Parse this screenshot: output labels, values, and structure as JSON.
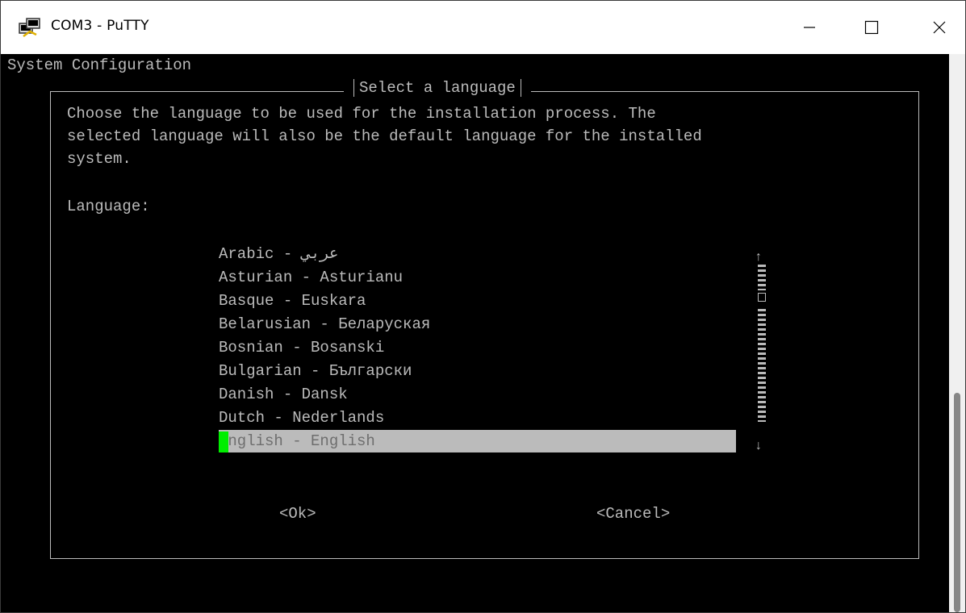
{
  "window": {
    "title": "COM3 - PuTTY",
    "icon": "putty-terminal-icon"
  },
  "terminal": {
    "system_title": "System Configuration",
    "dialog": {
      "title": "Select a language",
      "prompt_lines": [
        "Choose the language to be used for the installation process. The",
        "selected language will also be the default language for the installed",
        "system."
      ],
      "list_label": "Language:",
      "languages": [
        "Arabic - عربي",
        "Asturian - Asturianu",
        "Basque - Euskara",
        "Belarusian - Беларуская",
        "Bosnian - Bosanski",
        "Bulgarian - Български",
        "Danish - Dansk",
        "Dutch - Nederlands",
        "English - English"
      ],
      "selected_index": 8,
      "ok_label": "<Ok>",
      "cancel_label": "<Cancel>"
    }
  },
  "colors": {
    "terminal_bg": "#000000",
    "terminal_fg": "#bbbbbb",
    "selection_bg": "#bbbbbb",
    "cursor": "#00ee00"
  }
}
